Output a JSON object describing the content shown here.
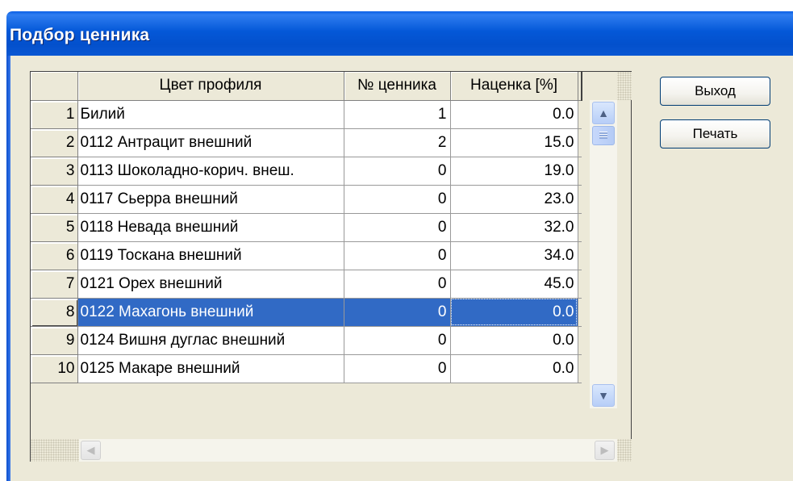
{
  "window": {
    "title": "Подбор ценника"
  },
  "table": {
    "headers": [
      "",
      "Цвет профиля",
      "№ ценника",
      "Наценка [%]"
    ],
    "rows": [
      {
        "num": "1",
        "color": "Билий",
        "tag": "1",
        "markup": "0.0"
      },
      {
        "num": "2",
        "color": "0112  Антрацит внешний",
        "tag": "2",
        "markup": "15.0"
      },
      {
        "num": "3",
        "color": "0113 Шоколадно-корич. внеш.",
        "tag": "0",
        "markup": "19.0"
      },
      {
        "num": "4",
        "color": "0117 Сьерра внешний",
        "tag": "0",
        "markup": "23.0"
      },
      {
        "num": "5",
        "color": "0118 Невада внешний",
        "tag": "0",
        "markup": "32.0"
      },
      {
        "num": "6",
        "color": "0119 Тоскана внешний",
        "tag": "0",
        "markup": "34.0"
      },
      {
        "num": "7",
        "color": "0121 Орех внешний",
        "tag": "0",
        "markup": "45.0"
      },
      {
        "num": "8",
        "color": "0122 Махагонь внешний",
        "tag": "0",
        "markup": "0.0",
        "selected": true
      },
      {
        "num": "9",
        "color": "0124 Вишня дуглас внешний",
        "tag": "0",
        "markup": "0.0"
      },
      {
        "num": "10",
        "color": "0125 Макаре внешний",
        "tag": "0",
        "markup": "0.0"
      }
    ]
  },
  "buttons": {
    "exit": "Выход",
    "print": "Печать"
  },
  "scrollbars": {
    "up_icon": "▲",
    "down_icon": "▼",
    "left_icon": "◀",
    "right_icon": "▶"
  },
  "colors": {
    "titlebar": "#0458d8",
    "selection": "#316ac5",
    "window_bg": "#ece9d8"
  }
}
